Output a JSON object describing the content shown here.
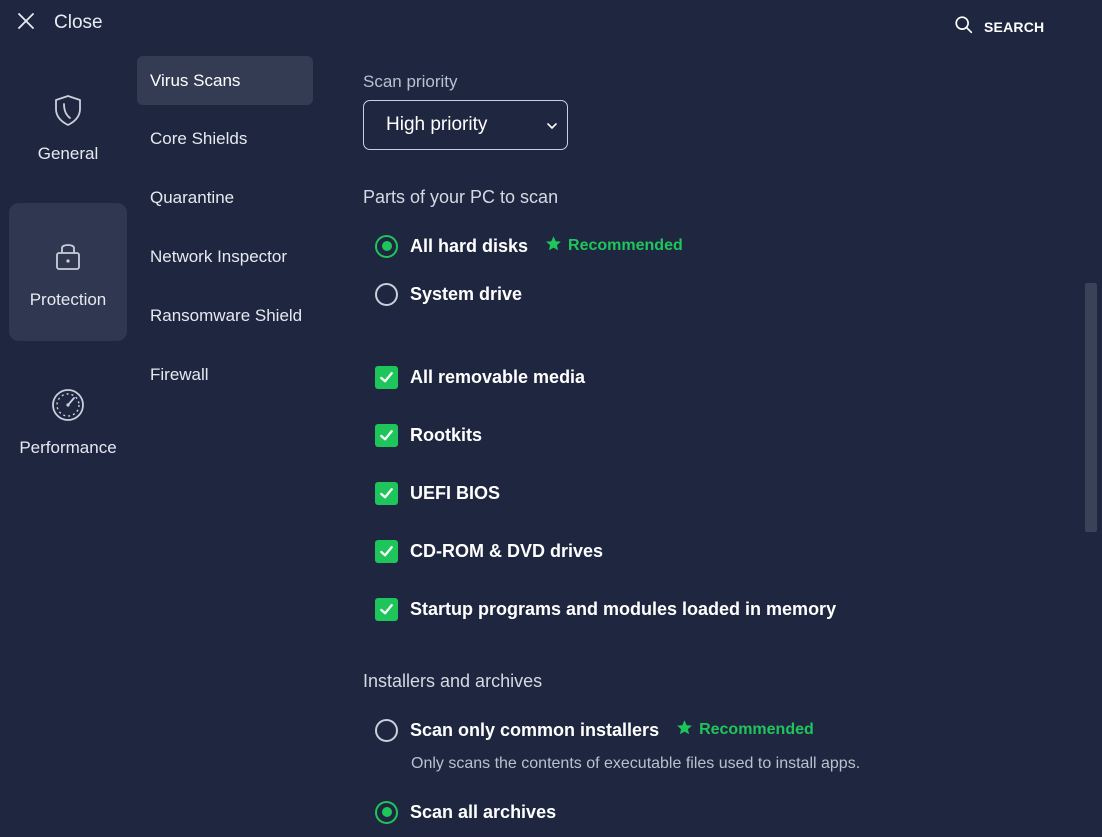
{
  "topbar": {
    "close_label": "Close",
    "close_icon": "close-icon",
    "search_label": "SEARCH",
    "search_icon": "search-icon"
  },
  "categories": [
    {
      "label": "General",
      "icon": "shield-icon",
      "active": false
    },
    {
      "label": "Protection",
      "icon": "lock-icon",
      "active": true
    },
    {
      "label": "Performance",
      "icon": "speedometer-icon",
      "active": false
    }
  ],
  "subnav": [
    {
      "label": "Virus Scans",
      "active": true
    },
    {
      "label": "Core Shields",
      "active": false
    },
    {
      "label": "Quarantine",
      "active": false
    },
    {
      "label": "Network Inspector",
      "active": false
    },
    {
      "label": "Ransomware Shield",
      "active": false
    },
    {
      "label": "Firewall",
      "active": false
    }
  ],
  "scan_priority": {
    "label": "Scan priority",
    "value": "High priority"
  },
  "parts_to_scan": {
    "label": "Parts of your PC to scan",
    "radios": [
      {
        "label": "All hard disks",
        "checked": true,
        "badge": "Recommended"
      },
      {
        "label": "System drive",
        "checked": false
      }
    ],
    "checkboxes": [
      {
        "label": "All removable media",
        "checked": true
      },
      {
        "label": "Rootkits",
        "checked": true
      },
      {
        "label": "UEFI BIOS",
        "checked": true
      },
      {
        "label": "CD-ROM & DVD drives",
        "checked": true
      },
      {
        "label": "Startup programs and modules loaded in memory",
        "checked": true
      }
    ]
  },
  "installers": {
    "label": "Installers and archives",
    "options": [
      {
        "label": "Scan only common installers",
        "checked": false,
        "badge": "Recommended",
        "helper": "Only scans the contents of executable files used to install apps."
      },
      {
        "label": "Scan all archives",
        "checked": true
      }
    ]
  },
  "colors": {
    "background": "#1f2740",
    "accent_green": "#1ec55a",
    "active_item": "#343c53"
  }
}
